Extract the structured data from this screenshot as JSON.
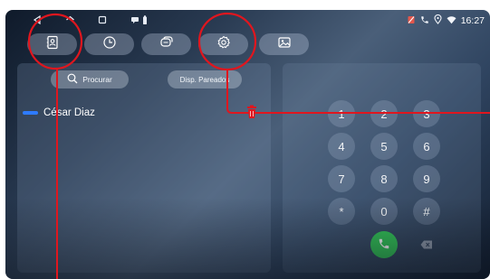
{
  "status_bar": {
    "time": "16:27",
    "nav_icons": [
      "back-icon",
      "home-icon",
      "recents-icon"
    ],
    "notification_icons": [
      "chat-icon",
      "battery-icon"
    ],
    "right_icons": [
      "no-sim-icon",
      "phone-icon",
      "location-icon",
      "wifi-icon"
    ]
  },
  "tabs": [
    {
      "icon": "contacts-icon",
      "selected": true
    },
    {
      "icon": "clock-icon",
      "selected": false
    },
    {
      "icon": "messages-icon",
      "selected": false
    },
    {
      "icon": "gear-icon",
      "selected": true
    },
    {
      "icon": "image-icon",
      "selected": false
    }
  ],
  "contacts_panel": {
    "search_label": "Procurar",
    "paired_label": "Disp. Pareados",
    "contacts": [
      {
        "name": "César Diaz",
        "accent_color": "#2e7bff"
      }
    ]
  },
  "keypad": {
    "keys": [
      "1",
      "2",
      "3",
      "4",
      "5",
      "6",
      "7",
      "8",
      "9",
      "*",
      "0",
      "#"
    ],
    "call_icon": "phone-call-icon",
    "backspace_icon": "backspace-icon"
  },
  "annotation": {
    "color": "#e0161e",
    "delete_icon": "trash-icon"
  }
}
